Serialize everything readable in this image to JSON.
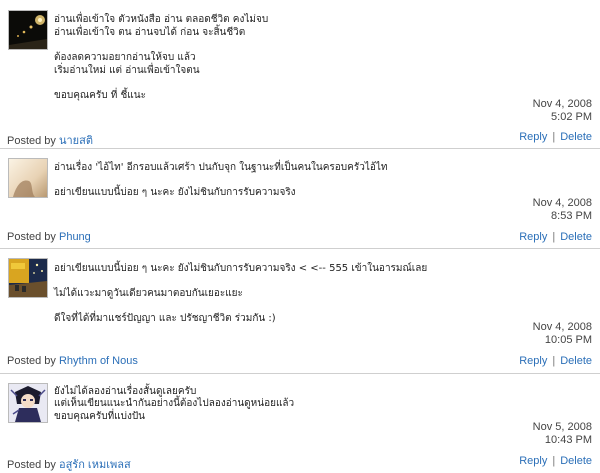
{
  "posted_by_label": "Posted by",
  "reply_label": "Reply",
  "delete_label": "Delete",
  "separator": "|",
  "comments": [
    {
      "lines": [
        "อ่านเพื่อเข้าใจ ตัวหนังสือ อ่าน ตลอดชีวิต คงไม่จบ",
        "อ่านเพื่อเข้าใจ ตน อ่านจบได้ ก่อน จะสิ้นชีวิต",
        "ต้องลดความอยากอ่านให้จบ แล้ว",
        "เริ่มอ่านใหม่ แต่ อ่านเพื่อเข้าใจตน",
        "ขอบคุณครับ ที่ ชี้แนะ"
      ],
      "date": "Nov 4, 2008",
      "time": "5:02 PM",
      "author": "นายสติ",
      "avatar_icon": "night-street-lights-avatar"
    },
    {
      "lines": [
        "อ่านเรื่อง 'ไอ้ไท' อีกรอบแล้วเศร้า ปนกับจุก ในฐานะที่เป็นคนในครอบครัวไอ้ไท",
        "อย่าเขียนแบบนี้บ่อย ๆ นะคะ ยังไม่ชินกับการรับความจริง"
      ],
      "date": "Nov 4, 2008",
      "time": "8:53 PM",
      "author": "Phung",
      "avatar_icon": "soft-light-avatar"
    },
    {
      "lines": [
        "อย่าเขียนแบบนี้บ่อย ๆ นะคะ ยังไม่ชินกับการรับความจริง < <-- 555 เข้าในอารมณ์เลย",
        "ไม่ได้แวะมาดูวันเดียวคนมาตอบกันเยอะแยะ",
        "ดีใจที่ได้ที่มาแชร์ปัญญา และ ปรัชญาชีวิต ร่วมกัน :)"
      ],
      "date": "Nov 4, 2008",
      "time": "10:05 PM",
      "author": "Rhythm of Nous",
      "avatar_icon": "cafe-terrace-night-avatar"
    },
    {
      "lines": [
        "ยังไม่ได้ลองอ่านเรื่องสั้นดูเลยครับ",
        "แต่เห็นเขียนแนะนำกันอย่างนี้ต้องไปลองอ่านดูหน่อยแล้ว",
        "ขอบคุณครับที่แบ่งปัน"
      ],
      "date": "Nov 5, 2008",
      "time": "10:43 PM",
      "author": "อสูรัก เหมเพลส",
      "avatar_icon": "anime-character-avatar"
    }
  ]
}
